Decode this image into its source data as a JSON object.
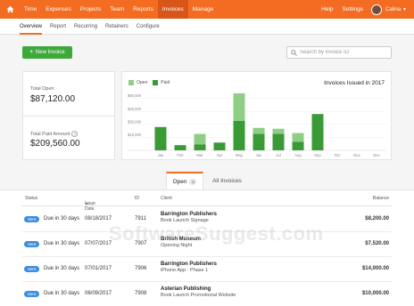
{
  "topnav": {
    "items": [
      {
        "label": "Time"
      },
      {
        "label": "Expenses"
      },
      {
        "label": "Projects"
      },
      {
        "label": "Team"
      },
      {
        "label": "Reports"
      },
      {
        "label": "Invoices",
        "active": true
      },
      {
        "label": "Manage"
      }
    ],
    "help": "Help",
    "settings": "Settings",
    "user": "Calina"
  },
  "subnav": {
    "items": [
      {
        "label": "Overview",
        "active": true
      },
      {
        "label": "Report"
      },
      {
        "label": "Recurring"
      },
      {
        "label": "Retainers"
      },
      {
        "label": "Configure"
      }
    ]
  },
  "new_invoice": {
    "label": "New Invoice"
  },
  "search": {
    "placeholder": "Search by invoice ID"
  },
  "stats": {
    "total_open_label": "Total Open",
    "total_open_value": "$87,120.00",
    "total_paid_label": "Total Paid Amount",
    "total_paid_value": "$209,560.00"
  },
  "chart_data": {
    "type": "bar",
    "stacked": true,
    "title": "Invoices Issued in 2017",
    "categories": [
      "Jan",
      "Feb",
      "Mar",
      "Apr",
      "May",
      "Jun",
      "Jul",
      "Aug",
      "Sep",
      "Oct",
      "Nov",
      "Dec"
    ],
    "series": [
      {
        "name": "Paid",
        "color": "#3a9a35",
        "values": [
          27000,
          6000,
          7000,
          9000,
          34000,
          19000,
          19000,
          10000,
          42000,
          0,
          0,
          0
        ]
      },
      {
        "name": "Open",
        "color": "#8fce85",
        "values": [
          0,
          0,
          12000,
          0,
          32000,
          7000,
          6000,
          10000,
          0,
          0,
          0,
          0
        ]
      }
    ],
    "yticks": [
      "$60,000",
      "$45,000",
      "$30,000",
      "$15,000"
    ],
    "ylim": [
      0,
      70000
    ],
    "legend": "top-left"
  },
  "tabs": {
    "open_label": "Open",
    "open_count": "4",
    "all_label": "All Invoices"
  },
  "table": {
    "headers": {
      "status": "Status",
      "issue_date": "Issue Date",
      "sort_indicator": "▲",
      "id": "ID",
      "client": "Client",
      "balance": "Balance"
    },
    "rows": [
      {
        "status": "Sent",
        "due": "Due in 30 days",
        "date": "08/18/2017",
        "id": "7911",
        "client": "Barrington Publishers",
        "desc": "Book Launch Signage",
        "balance": "$8,200.00"
      },
      {
        "status": "Sent",
        "due": "Due in 30 days",
        "date": "07/07/2017",
        "id": "7907",
        "client": "British Museum",
        "desc": "Opening Night",
        "balance": "$7,520.00"
      },
      {
        "status": "Sent",
        "due": "Due in 30 days",
        "date": "07/01/2017",
        "id": "7906",
        "client": "Barrington Publishers",
        "desc": "iPhone App - Phase 1",
        "balance": "$14,000.00"
      },
      {
        "status": "Sent",
        "due": "Due in 30 days",
        "date": "06/09/2017",
        "id": "7908",
        "client": "Asterian Publishing",
        "desc": "Book Launch Promotional Website",
        "balance": "$10,000.00"
      }
    ]
  },
  "watermark": "SoftwareSuggest.com",
  "colors": {
    "brand": "#f36c21",
    "primary_button": "#3ea93b",
    "status_sent": "#3b8de0"
  }
}
